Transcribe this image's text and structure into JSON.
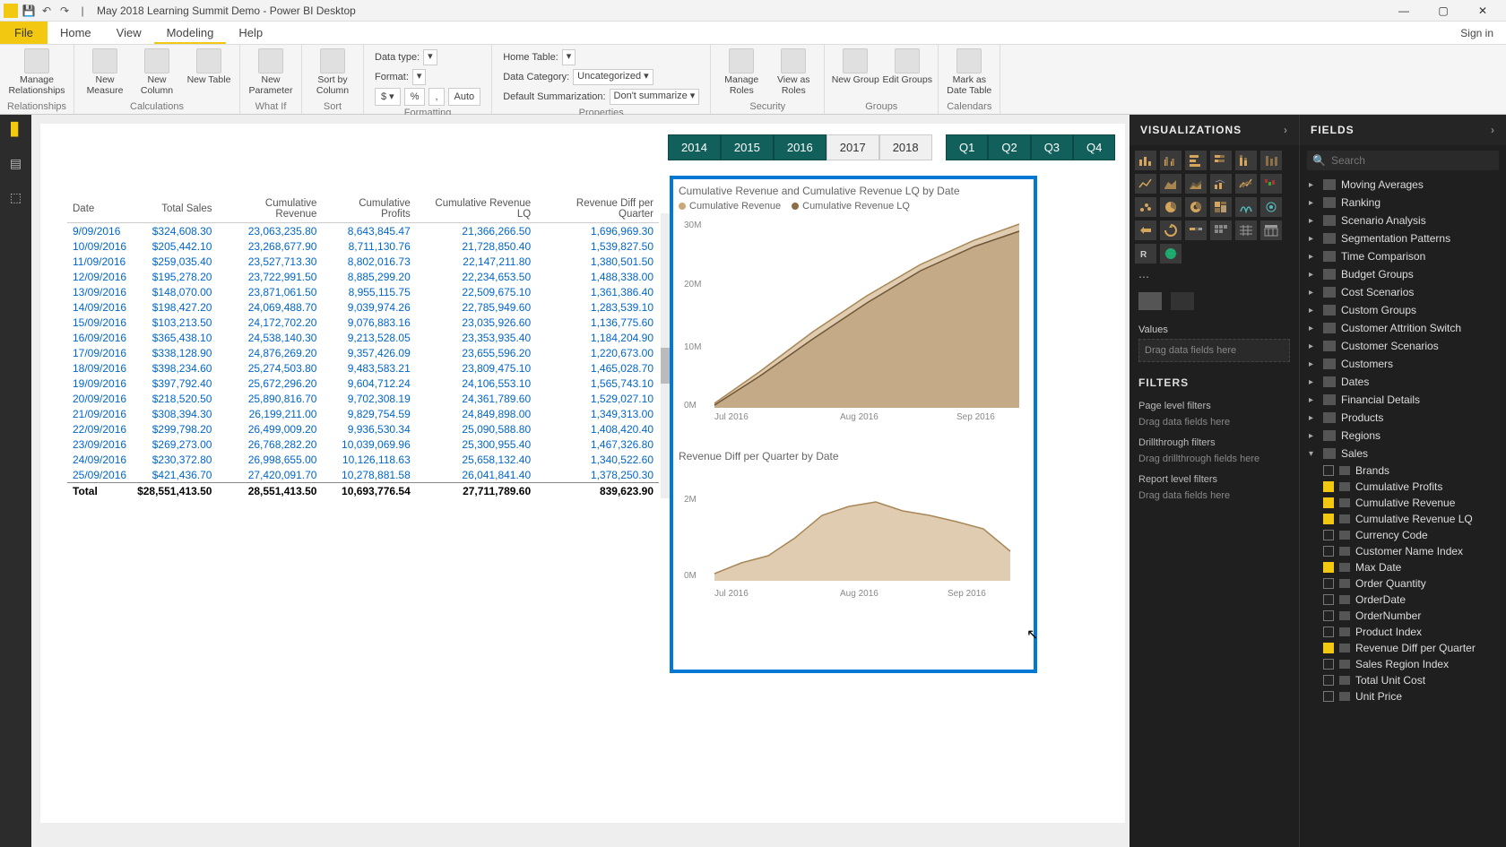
{
  "titlebar": {
    "title": "May 2018 Learning Summit Demo - Power BI Desktop"
  },
  "menus": {
    "file": "File",
    "tabs": [
      "Home",
      "View",
      "Modeling",
      "Help"
    ],
    "active": "Modeling",
    "signin": "Sign in"
  },
  "ribbon": {
    "relationships": {
      "manage": "Manage\nRelationships",
      "label": "Relationships"
    },
    "calculations": {
      "measure": "New\nMeasure",
      "column": "New\nColumn",
      "table": "New\nTable",
      "label": "Calculations"
    },
    "whatif": {
      "param": "New\nParameter",
      "label": "What If"
    },
    "sort": {
      "sortby": "Sort by\nColumn",
      "label": "Sort"
    },
    "formatting": {
      "datatype": "Data type:",
      "format": "Format:",
      "auto": "Auto",
      "label": "Formatting"
    },
    "properties": {
      "hometable": "Home Table:",
      "datacat": "Data Category:",
      "datacat_val": "Uncategorized",
      "defsum": "Default Summarization:",
      "defsum_val": "Don't summarize",
      "label": "Properties"
    },
    "security": {
      "manage": "Manage\nRoles",
      "viewas": "View as\nRoles",
      "label": "Security"
    },
    "groups": {
      "new": "New\nGroup",
      "edit": "Edit\nGroups",
      "label": "Groups"
    },
    "calendars": {
      "mark": "Mark as\nDate Table",
      "label": "Calendars"
    }
  },
  "slicers": {
    "years": [
      "2014",
      "2015",
      "2016",
      "2017",
      "2018"
    ],
    "years_off": [
      "2017",
      "2018"
    ],
    "quarters": [
      "Q1",
      "Q2",
      "Q3",
      "Q4"
    ]
  },
  "table": {
    "cols": [
      "Date",
      "Total Sales",
      "Cumulative Revenue",
      "Cumulative Profits",
      "Cumulative Revenue LQ",
      "Revenue Diff per Quarter"
    ],
    "rows": [
      [
        "9/09/2016",
        "$324,608.30",
        "23,063,235.80",
        "8,643,845.47",
        "21,366,266.50",
        "1,696,969.30"
      ],
      [
        "10/09/2016",
        "$205,442.10",
        "23,268,677.90",
        "8,711,130.76",
        "21,728,850.40",
        "1,539,827.50"
      ],
      [
        "11/09/2016",
        "$259,035.40",
        "23,527,713.30",
        "8,802,016.73",
        "22,147,211.80",
        "1,380,501.50"
      ],
      [
        "12/09/2016",
        "$195,278.20",
        "23,722,991.50",
        "8,885,299.20",
        "22,234,653.50",
        "1,488,338.00"
      ],
      [
        "13/09/2016",
        "$148,070.00",
        "23,871,061.50",
        "8,955,115.75",
        "22,509,675.10",
        "1,361,386.40"
      ],
      [
        "14/09/2016",
        "$198,427.20",
        "24,069,488.70",
        "9,039,974.26",
        "22,785,949.60",
        "1,283,539.10"
      ],
      [
        "15/09/2016",
        "$103,213.50",
        "24,172,702.20",
        "9,076,883.16",
        "23,035,926.60",
        "1,136,775.60"
      ],
      [
        "16/09/2016",
        "$365,438.10",
        "24,538,140.30",
        "9,213,528.05",
        "23,353,935.40",
        "1,184,204.90"
      ],
      [
        "17/09/2016",
        "$338,128.90",
        "24,876,269.20",
        "9,357,426.09",
        "23,655,596.20",
        "1,220,673.00"
      ],
      [
        "18/09/2016",
        "$398,234.60",
        "25,274,503.80",
        "9,483,583.21",
        "23,809,475.10",
        "1,465,028.70"
      ],
      [
        "19/09/2016",
        "$397,792.40",
        "25,672,296.20",
        "9,604,712.24",
        "24,106,553.10",
        "1,565,743.10"
      ],
      [
        "20/09/2016",
        "$218,520.50",
        "25,890,816.70",
        "9,702,308.19",
        "24,361,789.60",
        "1,529,027.10"
      ],
      [
        "21/09/2016",
        "$308,394.30",
        "26,199,211.00",
        "9,829,754.59",
        "24,849,898.00",
        "1,349,313.00"
      ],
      [
        "22/09/2016",
        "$299,798.20",
        "26,499,009.20",
        "9,936,530.34",
        "25,090,588.80",
        "1,408,420.40"
      ],
      [
        "23/09/2016",
        "$269,273.00",
        "26,768,282.20",
        "10,039,069.96",
        "25,300,955.40",
        "1,467,326.80"
      ],
      [
        "24/09/2016",
        "$230,372.80",
        "26,998,655.00",
        "10,126,118.63",
        "25,658,132.40",
        "1,340,522.60"
      ],
      [
        "25/09/2016",
        "$421,436.70",
        "27,420,091.70",
        "10,278,881.58",
        "26,041,841.40",
        "1,378,250.30"
      ]
    ],
    "total": [
      "Total",
      "$28,551,413.50",
      "28,551,413.50",
      "10,693,776.54",
      "27,711,789.60",
      "839,623.90"
    ]
  },
  "chart1": {
    "title": "Cumulative Revenue and Cumulative Revenue LQ by Date",
    "legend": [
      "Cumulative Revenue",
      "Cumulative Revenue LQ"
    ],
    "yticks": [
      "30M",
      "20M",
      "10M",
      "0M"
    ],
    "xticks": [
      "Jul 2016",
      "Aug 2016",
      "Sep 2016"
    ]
  },
  "chart2": {
    "title": "Revenue Diff per Quarter by Date",
    "yticks": [
      "2M",
      "0M"
    ],
    "xticks": [
      "Jul 2016",
      "Aug 2016",
      "Sep 2016"
    ]
  },
  "vizpanel": {
    "head": "VISUALIZATIONS",
    "values": "Values",
    "valdrop": "Drag data fields here",
    "filters": "FILTERS",
    "page": "Page level filters",
    "pagedrop": "Drag data fields here",
    "drill": "Drillthrough filters",
    "drilldrop": "Drag drillthrough fields here",
    "report": "Report level filters",
    "reportdrop": "Drag data fields here"
  },
  "fieldspanel": {
    "head": "FIELDS",
    "search": "Search",
    "tables": [
      "Moving Averages",
      "Ranking",
      "Scenario Analysis",
      "Segmentation Patterns",
      "Time Comparison",
      "Budget Groups",
      "Cost Scenarios",
      "Custom Groups",
      "Customer Attrition Switch",
      "Customer Scenarios",
      "Customers",
      "Dates",
      "Financial Details",
      "Products",
      "Regions"
    ],
    "expanded": "Sales",
    "fields": [
      {
        "name": "Brands",
        "checked": false
      },
      {
        "name": "Cumulative Profits",
        "checked": true
      },
      {
        "name": "Cumulative Revenue",
        "checked": true
      },
      {
        "name": "Cumulative Revenue LQ",
        "checked": true
      },
      {
        "name": "Currency Code",
        "checked": false
      },
      {
        "name": "Customer Name Index",
        "checked": false
      },
      {
        "name": "Max Date",
        "checked": true
      },
      {
        "name": "Order Quantity",
        "checked": false
      },
      {
        "name": "OrderDate",
        "checked": false
      },
      {
        "name": "OrderNumber",
        "checked": false
      },
      {
        "name": "Product Index",
        "checked": false
      },
      {
        "name": "Revenue Diff per Quarter",
        "checked": true
      },
      {
        "name": "Sales Region Index",
        "checked": false
      },
      {
        "name": "Total Unit Cost",
        "checked": false
      },
      {
        "name": "Unit Price",
        "checked": false
      }
    ]
  },
  "chart_data": [
    {
      "type": "area",
      "title": "Cumulative Revenue and Cumulative Revenue LQ by Date",
      "xlabel": "",
      "ylabel": "",
      "ylim": [
        0,
        30000000
      ],
      "x_ticks": [
        "Jul 2016",
        "Aug 2016",
        "Sep 2016"
      ],
      "series": [
        {
          "name": "Cumulative Revenue",
          "color": "#c9a97a",
          "x": [
            "2016-07-01",
            "2016-07-15",
            "2016-08-01",
            "2016-08-15",
            "2016-09-01",
            "2016-09-15",
            "2016-09-30"
          ],
          "values": [
            1000000,
            5000000,
            10000000,
            15000000,
            20000000,
            24000000,
            28500000
          ]
        },
        {
          "name": "Cumulative Revenue LQ",
          "color": "#8b6f47",
          "x": [
            "2016-07-01",
            "2016-07-15",
            "2016-08-01",
            "2016-08-15",
            "2016-09-01",
            "2016-09-15",
            "2016-09-30"
          ],
          "values": [
            800000,
            4500000,
            9000000,
            13500000,
            18500000,
            23000000,
            27700000
          ]
        }
      ]
    },
    {
      "type": "area",
      "title": "Revenue Diff per Quarter by Date",
      "xlabel": "",
      "ylabel": "",
      "ylim": [
        0,
        2000000
      ],
      "x_ticks": [
        "Jul 2016",
        "Aug 2016",
        "Sep 2016"
      ],
      "series": [
        {
          "name": "Revenue Diff per Quarter",
          "color": "#c9a97a",
          "x": [
            "2016-07-01",
            "2016-07-10",
            "2016-07-20",
            "2016-08-01",
            "2016-08-10",
            "2016-08-20",
            "2016-09-01",
            "2016-09-10",
            "2016-09-20",
            "2016-09-30"
          ],
          "values": [
            200000,
            500000,
            700000,
            1200000,
            1700000,
            1900000,
            1750000,
            1500000,
            1400000,
            840000
          ]
        }
      ]
    }
  ]
}
